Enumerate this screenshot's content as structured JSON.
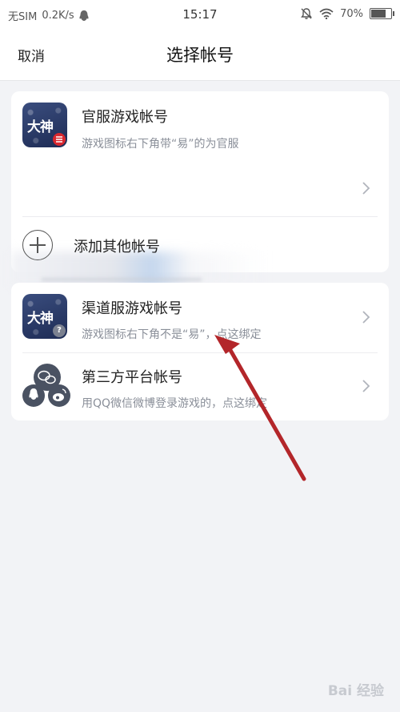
{
  "status_bar": {
    "carrier": "无SIM",
    "speed": "0.2K/s",
    "time": "15:17",
    "battery": "70%"
  },
  "navbar": {
    "cancel_label": "取消",
    "title": "选择帐号"
  },
  "official_section": {
    "icon_text": "大神",
    "title": "官服游戏帐号",
    "subtitle": "游戏图标右下角带“易”的为官服",
    "add_account_label": "添加其他帐号"
  },
  "channel_section": {
    "channel": {
      "icon_text": "大神",
      "badge": "?",
      "title": "渠道服游戏帐号",
      "subtitle": "游戏图标右下角不是“易”，点这绑定"
    },
    "third_party": {
      "title": "第三方平台帐号",
      "subtitle": "用QQ微信微博登录游戏的，点这绑定"
    }
  },
  "watermark": "Bai 经验",
  "colors": {
    "arrow": "#b3262a",
    "badge_official": "#d9282f",
    "badge_channel": "#7b8190",
    "icon_bg": "#2b3a66"
  }
}
